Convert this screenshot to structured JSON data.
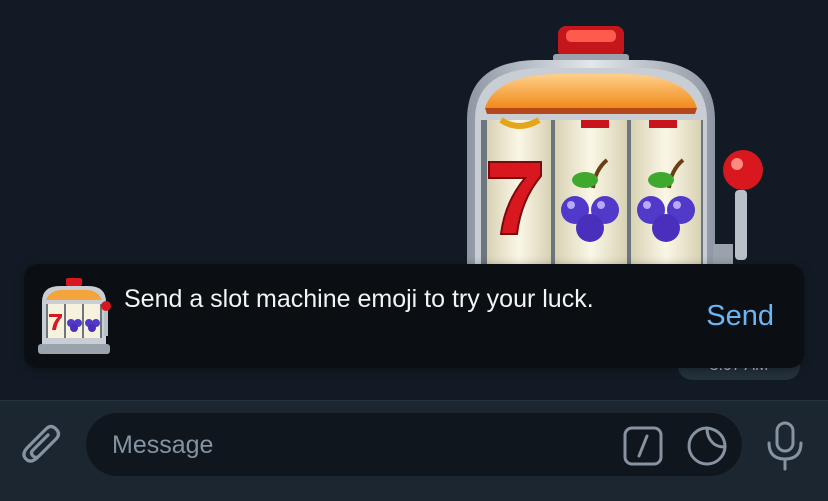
{
  "message": {
    "sticker_icon": "slot-machine-sticker",
    "time": "3:07 AM"
  },
  "toast": {
    "icon": "slot-machine-icon",
    "text": "Send a slot machine emoji to try your luck.",
    "action_label": "Send"
  },
  "composer": {
    "placeholder": "Message",
    "attach_icon": "paperclip-icon",
    "command_icon": "slash-command-icon",
    "sticker_icon": "sticker-icon",
    "mic_icon": "microphone-icon"
  },
  "colors": {
    "chat_background": "#121b25",
    "toast_background": "#0b0f13",
    "accent": "#6cb4f4",
    "composer_background": "#1c2631",
    "input_background": "#0f161d"
  }
}
